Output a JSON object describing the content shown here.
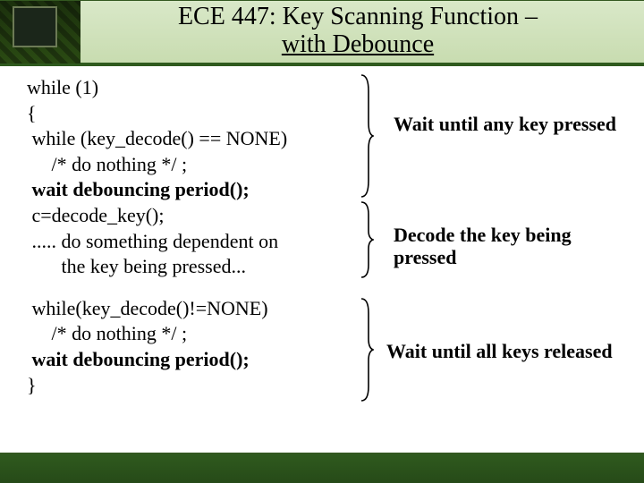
{
  "title_line1": "ECE 447: Key Scanning Function –",
  "title_line2": "with Debounce",
  "code": {
    "l0": "while (1)",
    "l1": "{",
    "l2": " while (key_decode() == NONE)",
    "l3": "     /* do nothing */ ;",
    "l4": " wait debouncing period();",
    "l5": " c=decode_key();",
    "l6": " ..... do something dependent on",
    "l7": "       the key being pressed...",
    "l8": " while(key_decode()!=NONE)",
    "l9": "     /* do nothing */ ;",
    "l10": " wait debouncing period();",
    "l11": "}"
  },
  "ann": {
    "a1": "Wait until any key pressed",
    "a2": "Decode the key being pressed",
    "a3": "Wait until all keys released"
  }
}
